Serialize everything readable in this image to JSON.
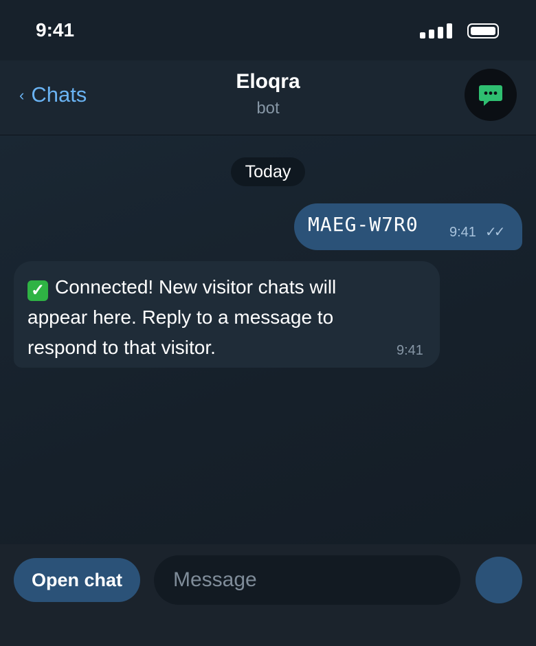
{
  "status_bar": {
    "time": "9:41"
  },
  "header": {
    "back_label": "Chats",
    "title": "Eloqra",
    "subtitle": "bot",
    "avatar_icon": "chat-bubble-icon",
    "avatar_color": "#2fbf71"
  },
  "chat": {
    "date_label": "Today",
    "messages": [
      {
        "direction": "outgoing",
        "text": "MAEG-W7R0",
        "time": "9:41",
        "status_icon": "double-check-icon"
      },
      {
        "direction": "incoming",
        "text": "Connected! New visitor chats will appear here. Reply to a message to respond to that visitor.",
        "emoji": "white-check-mark",
        "time": "9:41"
      }
    ]
  },
  "input_bar": {
    "open_chat_label": "Open chat",
    "message_placeholder": "Message",
    "message_value": ""
  },
  "colors": {
    "background": "#17212b",
    "accent": "#6ab3f3",
    "outgoing_bubble": "#2b5278",
    "incoming_bubble": "#1f2c38"
  }
}
